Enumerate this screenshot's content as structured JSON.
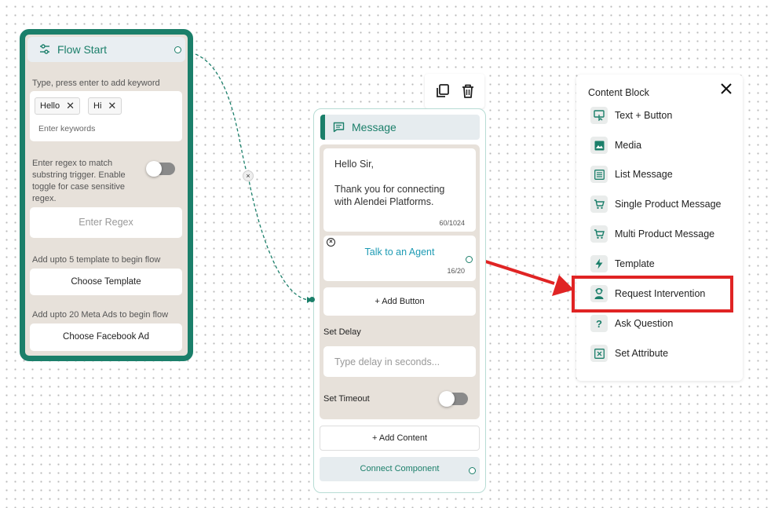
{
  "flow_start": {
    "title": "Flow Start",
    "keyword_label": "Type, press enter to add keyword",
    "keywords": [
      "Hello",
      "Hi"
    ],
    "keyword_placeholder": "Enter keywords",
    "regex_label": "Enter regex to match substring trigger. Enable toggle for case sensitive regex.",
    "regex_placeholder": "Enter Regex",
    "template_label": "Add upto 5 template to begin flow",
    "template_button": "Choose Template",
    "ads_label": "Add upto 20 Meta Ads to begin flow",
    "ads_button": "Choose Facebook Ad"
  },
  "connector": {
    "remove_glyph": "×"
  },
  "message_node": {
    "title": "Message",
    "text_line1": "Hello Sir,",
    "text_line2": "Thank you for connecting with Alendei Platforms.",
    "text_counter": "60/1024",
    "button_label": "Talk to an Agent",
    "button_counter": "16/20",
    "add_button": "+ Add Button",
    "set_delay_label": "Set Delay",
    "delay_placeholder": "Type delay in seconds...",
    "set_timeout_label": "Set Timeout",
    "add_content": "+ Add Content",
    "connect_component": "Connect Component"
  },
  "content_block": {
    "title": "Content Block",
    "items": [
      {
        "label": "Text + Button",
        "icon": "text-button-icon"
      },
      {
        "label": "Media",
        "icon": "image-icon"
      },
      {
        "label": "List Message",
        "icon": "list-icon"
      },
      {
        "label": "Single Product Message",
        "icon": "cart-icon"
      },
      {
        "label": "Multi Product Message",
        "icon": "cart-icon"
      },
      {
        "label": "Template",
        "icon": "bolt-icon"
      },
      {
        "label": "Request Intervention",
        "icon": "agent-icon"
      },
      {
        "label": "Ask Question",
        "icon": "question-icon"
      },
      {
        "label": "Set Attribute",
        "icon": "attribute-icon"
      }
    ],
    "highlighted_item": "Request Intervention"
  },
  "colors": {
    "brand": "#1b7f6a",
    "node_background": "#e7e1da",
    "link": "#1e9bb4",
    "annotation": "#e02424"
  }
}
